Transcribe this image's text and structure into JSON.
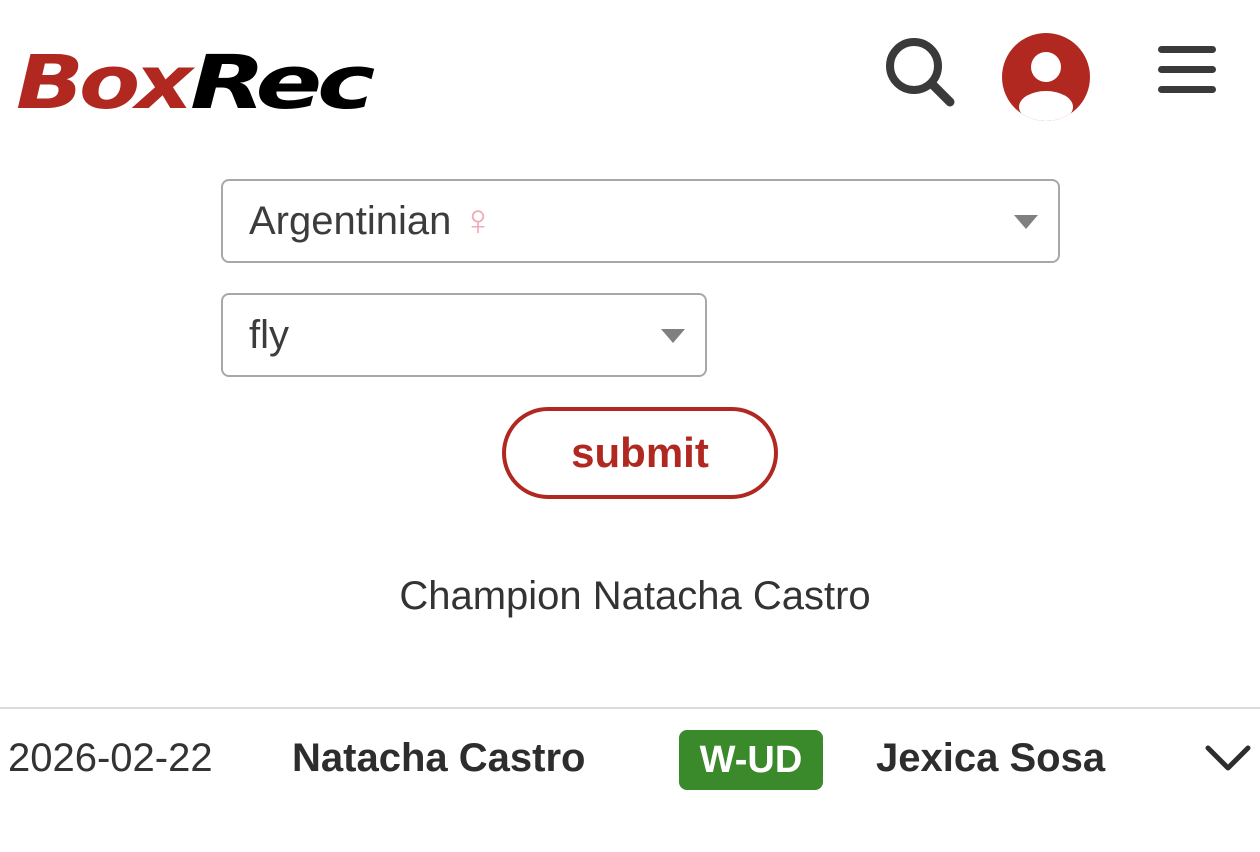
{
  "header": {
    "logo_part1": "Box",
    "logo_part2": "Rec",
    "icons": [
      "search-icon",
      "user-avatar-icon",
      "hamburger-menu-icon"
    ],
    "colors": {
      "brand_red": "#b0281f",
      "logo_black": "#000000",
      "icon_gray": "#3a3a3a"
    }
  },
  "filters": {
    "nationality": {
      "value": "Argentinian",
      "symbol": "♀",
      "symbol_color": "#f0a9b8"
    },
    "division": {
      "value": "fly"
    },
    "submit_label": "submit"
  },
  "champion_text": "Champion Natacha Castro",
  "bouts": [
    {
      "date": "2026-02-22",
      "fighter": "Natacha Castro",
      "result": "W-UD",
      "result_color": "#3a8a2c",
      "opponent": "Jexica Sosa",
      "expand_icon": "chevron-down-icon"
    }
  ]
}
